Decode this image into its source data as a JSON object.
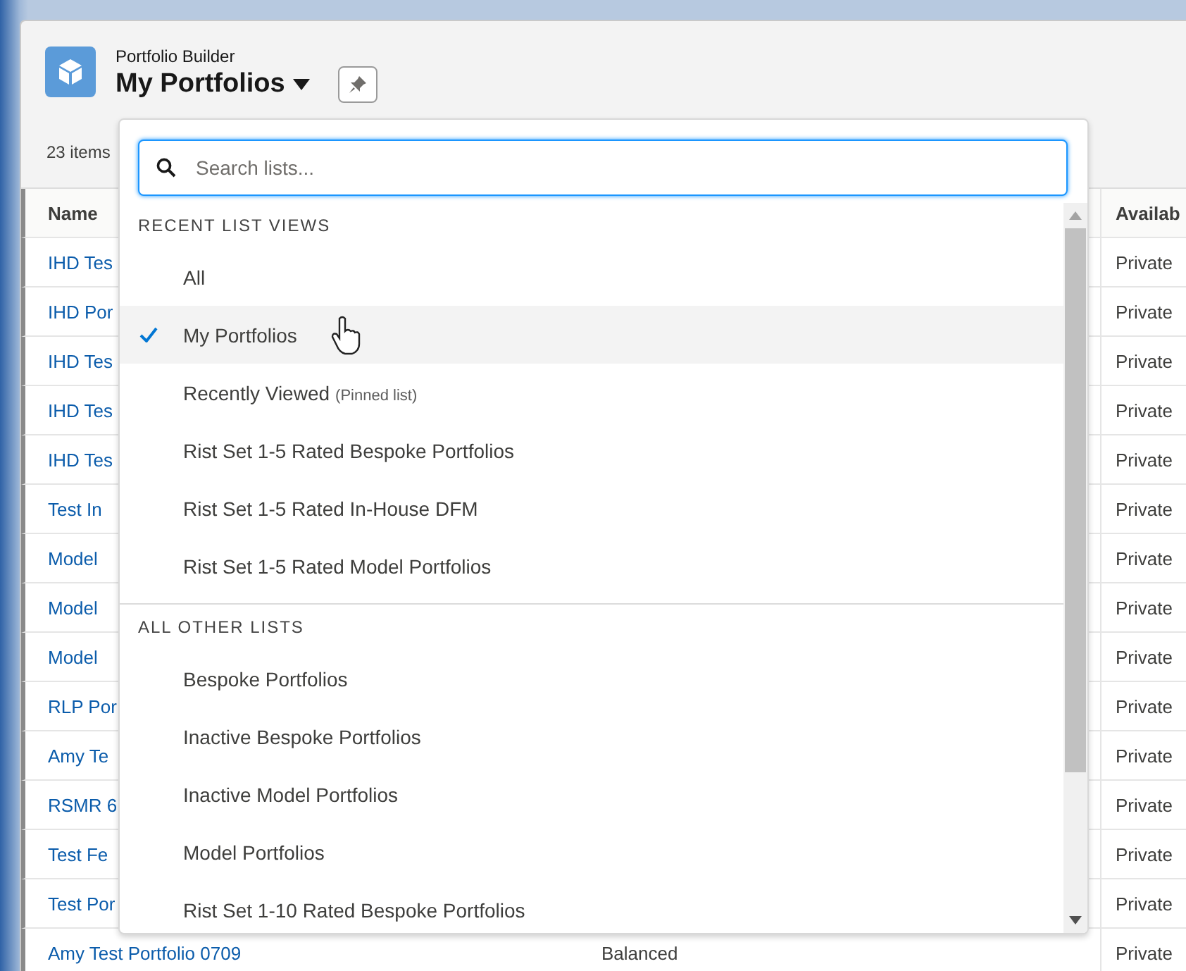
{
  "header": {
    "app_name": "Portfolio Builder",
    "list_title": "My Portfolios",
    "item_count": "23 items"
  },
  "table": {
    "headers": {
      "name": "Name",
      "column_3": "Availab"
    },
    "rows": [
      {
        "name": "IHD Tes",
        "column_3": "Private"
      },
      {
        "name": "IHD Por",
        "column_3": "Private"
      },
      {
        "name": "IHD Tes",
        "column_3": "Private"
      },
      {
        "name": "IHD Tes",
        "column_3": "Private"
      },
      {
        "name": "IHD Tes",
        "column_3": "Private"
      },
      {
        "name": "Test In",
        "column_3": "Private"
      },
      {
        "name": "Model",
        "column_3": "Private"
      },
      {
        "name": "Model",
        "column_3": "Private"
      },
      {
        "name": "Model",
        "column_3": "Private"
      },
      {
        "name": "RLP Por",
        "column_3": "Private"
      },
      {
        "name": "Amy Te",
        "column_3": "Private"
      },
      {
        "name": "RSMR 6",
        "column_3": "Private"
      },
      {
        "name": "Test Fe",
        "column_3": "Private"
      },
      {
        "name": "Test Por",
        "column_3": "Private"
      },
      {
        "name": "Amy Test Portfolio 0709",
        "column_2": "Balanced",
        "column_3": "Private"
      }
    ]
  },
  "list_menu": {
    "search": {
      "placeholder": "Search lists..."
    },
    "sections": [
      {
        "heading": "RECENT LIST VIEWS",
        "items": [
          {
            "label": "All",
            "selected": false,
            "hovered": false
          },
          {
            "label": "My Portfolios",
            "selected": true,
            "hovered": true
          },
          {
            "label": "Recently Viewed",
            "note": "(Pinned list)",
            "selected": false,
            "hovered": false
          },
          {
            "label": "Rist Set 1-5 Rated Bespoke Portfolios",
            "selected": false,
            "hovered": false
          },
          {
            "label": "Rist Set 1-5 Rated In-House DFM",
            "selected": false,
            "hovered": false
          },
          {
            "label": "Rist Set 1-5 Rated Model Portfolios",
            "selected": false,
            "hovered": false
          }
        ]
      },
      {
        "heading": "ALL OTHER LISTS",
        "items": [
          {
            "label": "Bespoke Portfolios",
            "selected": false,
            "hovered": false
          },
          {
            "label": "Inactive Bespoke Portfolios",
            "selected": false,
            "hovered": false
          },
          {
            "label": "Inactive Model Portfolios",
            "selected": false,
            "hovered": false
          },
          {
            "label": "Model Portfolios",
            "selected": false,
            "hovered": false
          },
          {
            "label": "Rist Set 1-10 Rated Bespoke Portfolios",
            "selected": false,
            "hovered": false
          }
        ]
      }
    ]
  }
}
